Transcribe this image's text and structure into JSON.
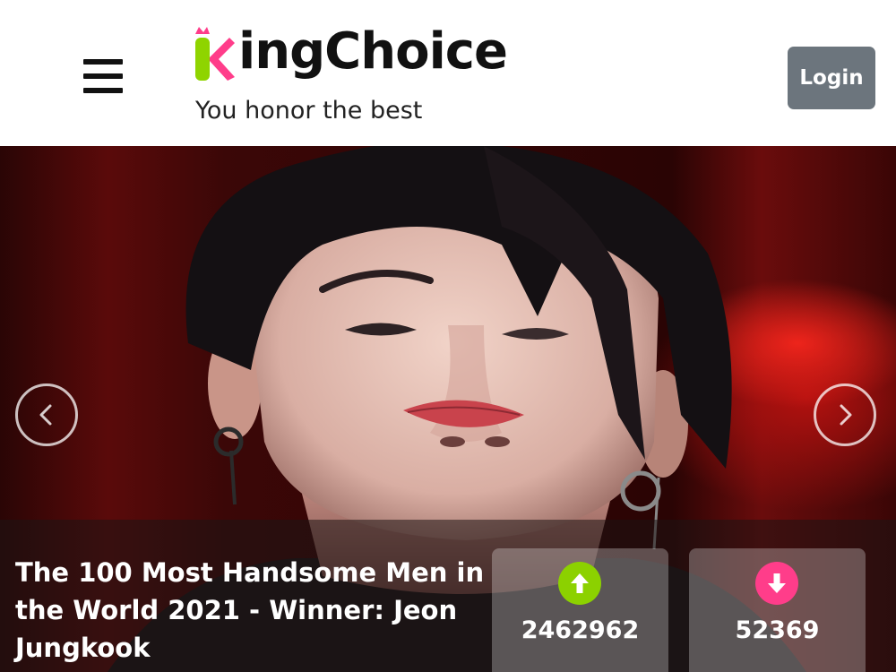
{
  "header": {
    "logo_text": "ingChoice",
    "logo_letter": "K",
    "tagline": "You honor the best",
    "login_label": "Login"
  },
  "hero": {
    "title": "The 100 Most Handsome Men in the World 2021 - Winner: Jeon Jungkook",
    "upvotes": "2462962",
    "downvotes": "52369"
  },
  "colors": {
    "logo_green": "#8fd400",
    "logo_pink": "#ff3d8a",
    "login_bg": "#6c757d",
    "upvote_green": "#8cd100",
    "downvote_pink": "#ff3d8a"
  },
  "icons": {
    "menu": "hamburger-icon",
    "prev": "chevron-left-icon",
    "next": "chevron-right-icon",
    "upvote": "arrow-up-icon",
    "downvote": "arrow-down-icon"
  }
}
